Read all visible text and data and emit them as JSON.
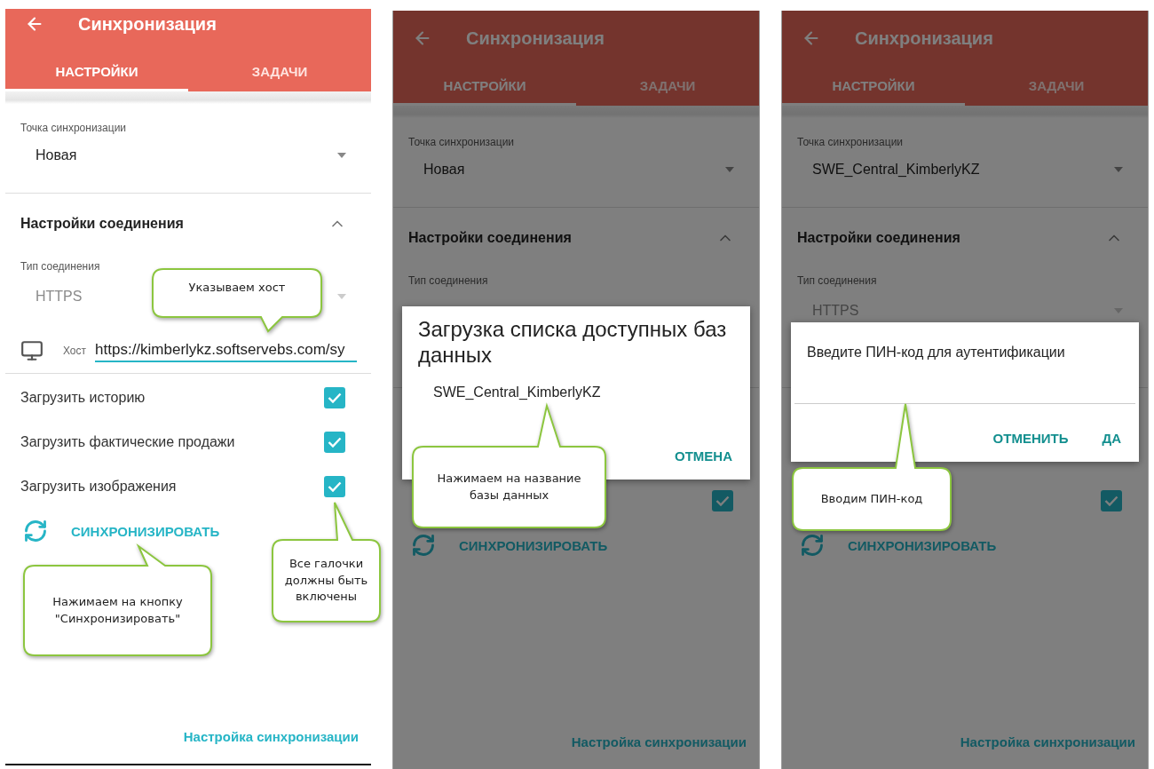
{
  "screens": [
    {
      "title": "Синхронизация",
      "tabs": [
        {
          "label": "НАСТРОЙКИ",
          "selected": true
        },
        {
          "label": "ЗАДАЧИ",
          "selected": false
        }
      ],
      "sync_point": {
        "label": "Точка синхронизации",
        "value": "Новая"
      },
      "connection": {
        "title": "Настройки соединения",
        "expanded": true,
        "type_label": "Тип соединения",
        "type_value": "HTTPS",
        "type_disabled": true,
        "host_label": "Хост",
        "host_value": "https://kimberlykz.softservebs.com/sy"
      },
      "options": [
        {
          "label": "Загрузить историю",
          "checked": true
        },
        {
          "label": "Загрузить фактические продажи",
          "checked": true
        },
        {
          "label": "Загрузить изображения",
          "checked": true
        }
      ],
      "sync_button": "СИНХРОНИЗИРОВАТЬ",
      "footer_link": "Настройка синхронизации",
      "callouts": [
        {
          "text": "Указываем хост"
        },
        {
          "text": "Нажимаем на кнопку \"Синхронизировать\""
        },
        {
          "text": "Все галочки должны быть включены"
        }
      ]
    },
    {
      "title": "Синхронизация",
      "tabs": [
        {
          "label": "НАСТРОЙКИ",
          "selected": true
        },
        {
          "label": "ЗАДАЧИ",
          "selected": false
        }
      ],
      "sync_point": {
        "label": "Точка синхронизации",
        "value": "Новая"
      },
      "connection": {
        "title": "Настройки соединения",
        "expanded": true,
        "type_label": "Тип соединения"
      },
      "options": [
        {
          "checked": true
        }
      ],
      "sync_button": "СИНХРОНИЗИРОВАТЬ",
      "footer_link": "Настройка синхронизации",
      "dialog": {
        "kind": "list",
        "title": "Загрузка списка доступных баз данных",
        "items": [
          "SWE_Central_KimberlyKZ"
        ],
        "buttons": [
          "ОТМЕНА"
        ]
      },
      "callouts": [
        {
          "text": "Нажимаем на название базы данных"
        }
      ]
    },
    {
      "title": "Синхронизация",
      "tabs": [
        {
          "label": "НАСТРОЙКИ",
          "selected": true
        },
        {
          "label": "ЗАДАЧИ",
          "selected": false
        }
      ],
      "sync_point": {
        "label": "Точка синхронизации",
        "value": "SWE_Central_KimberlyKZ"
      },
      "connection": {
        "title": "Настройки соединения",
        "expanded": true,
        "type_label": "Тип соединения",
        "type_value": "HTTPS",
        "type_disabled": true
      },
      "options": [
        {
          "checked": true
        }
      ],
      "sync_button": "СИНХРОНИЗИРОВАТЬ",
      "footer_link": "Настройка синхронизации",
      "dialog": {
        "kind": "pin",
        "title": "Введите ПИН-код для аутентификации",
        "buttons": [
          "ОТМЕНИТЬ",
          "ДА"
        ]
      },
      "callouts": [
        {
          "text": "Вводим ПИН-код"
        }
      ]
    }
  ]
}
